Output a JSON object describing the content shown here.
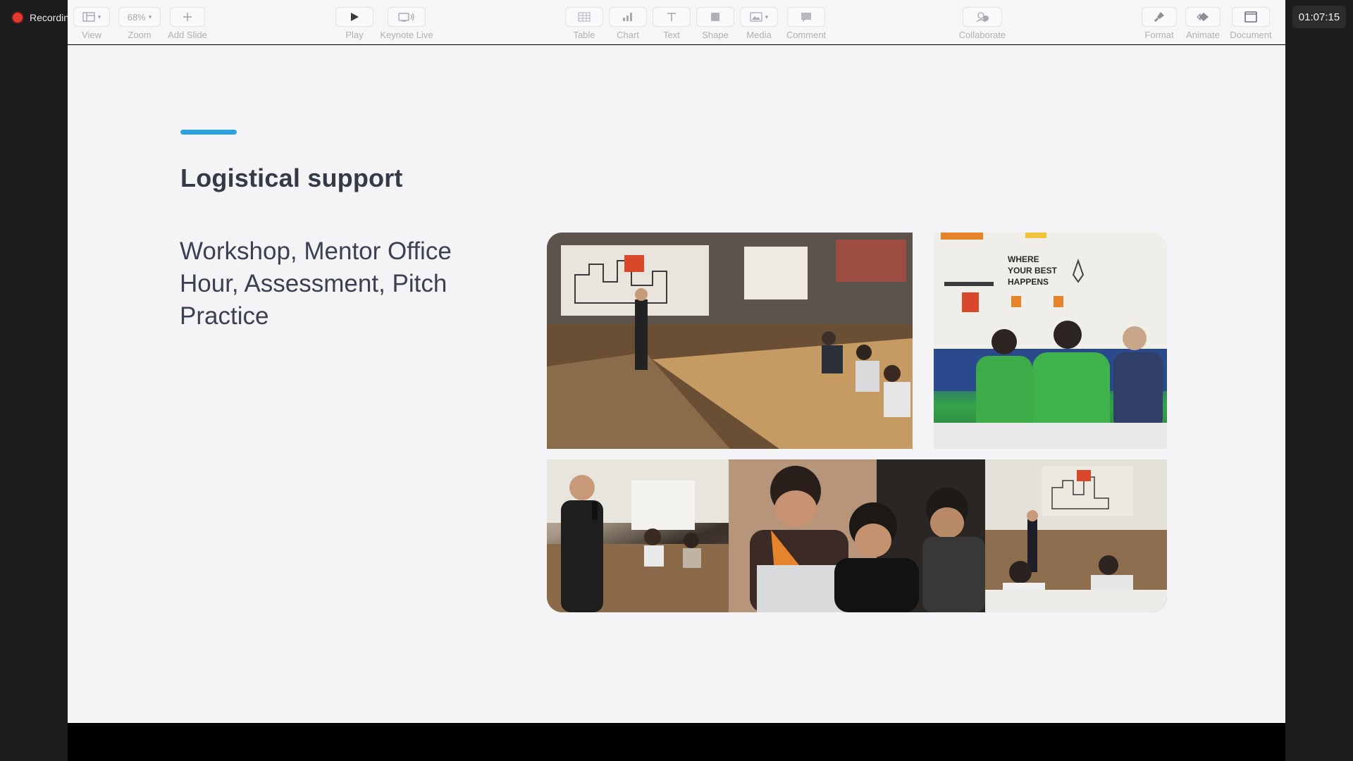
{
  "recording": {
    "label": "Recording"
  },
  "timer": {
    "value": "01:07:15"
  },
  "toolbar": {
    "view_label": "View",
    "zoom_value": "68%",
    "zoom_label": "Zoom",
    "add_slide_label": "Add Slide",
    "play_label": "Play",
    "keynote_live_label": "Keynote Live",
    "table_label": "Table",
    "chart_label": "Chart",
    "text_label": "Text",
    "shape_label": "Shape",
    "media_label": "Media",
    "comment_label": "Comment",
    "collaborate_label": "Collaborate",
    "format_label": "Format",
    "animate_label": "Animate",
    "document_label": "Document"
  },
  "slide": {
    "title": "Logistical support",
    "body": "Workshop, Mentor Office Hour, Assessment, Pitch Practice",
    "accent_color": "#2ea3e0",
    "photo2_sign": [
      "WHERE",
      "YOUR BEST",
      "HAPPENS"
    ]
  }
}
